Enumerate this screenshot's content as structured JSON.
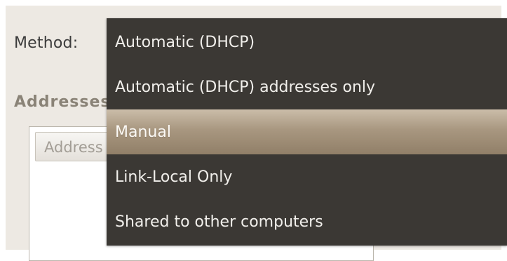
{
  "method": {
    "label": "Method:"
  },
  "addresses": {
    "heading": "Addresses",
    "column_header": "Address"
  },
  "dropdown": {
    "selected_index": 2,
    "options": [
      "Automatic (DHCP)",
      "Automatic (DHCP) addresses only",
      "Manual",
      "Link-Local Only",
      "Shared to other computers"
    ]
  },
  "colors": {
    "window_bg": "#ede9e3",
    "menu_bg": "#3b3834",
    "menu_text": "#f1efeb",
    "highlight": "#a89780"
  }
}
